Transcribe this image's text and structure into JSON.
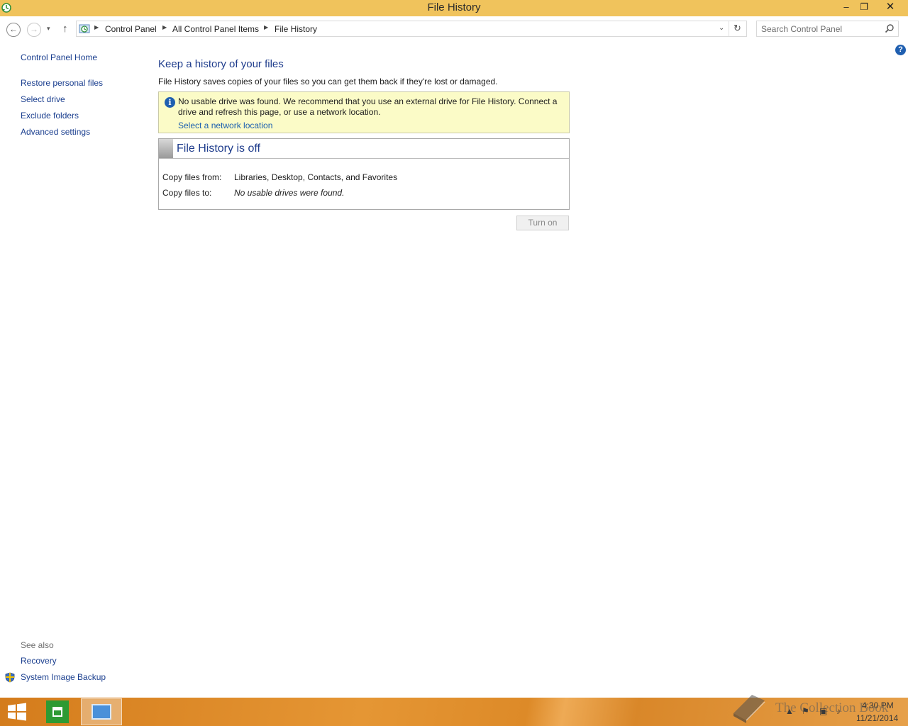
{
  "window": {
    "title": "File History",
    "minimize": "–",
    "maximize": "❐",
    "close": "✕"
  },
  "nav": {
    "back": "←",
    "forward": "→",
    "recent": "▾",
    "up": "↑",
    "breadcrumbs": [
      "Control Panel",
      "All Control Panel Items",
      "File History"
    ],
    "dropdown": "⌄",
    "refresh": "↻",
    "search_placeholder": "Search Control Panel"
  },
  "left_pane": {
    "home": "Control Panel Home",
    "tasks": [
      "Restore personal files",
      "Select drive",
      "Exclude folders",
      "Advanced settings"
    ],
    "see_also_label": "See also",
    "see_also": [
      "Recovery",
      "System Image Backup"
    ]
  },
  "main": {
    "title": "Keep a history of your files",
    "description": "File History saves copies of your files so you can get them back if they're lost or damaged.",
    "warning": {
      "message": "No usable drive was found. We recommend that you use an external drive for File History. Connect a drive and refresh this page, or use a network location.",
      "link": "Select a network location"
    },
    "status": {
      "title": "File History is off",
      "copy_from_label": "Copy files from:",
      "copy_from_value": "Libraries, Desktop, Contacts, and Favorites",
      "copy_to_label": "Copy files to:",
      "copy_to_value": "No usable drives were found."
    },
    "turn_on": "Turn on",
    "help": "?"
  },
  "taskbar": {
    "time": "4:30 PM",
    "date": "11/21/2014",
    "watermark": "The Collection Book"
  },
  "icons": {
    "app": "file-history-icon",
    "info": "info-icon",
    "help": "help-icon",
    "shield": "uac-shield-icon",
    "start": "windows-start-icon",
    "store": "store-icon",
    "control_panel": "control-panel-icon",
    "search": "magnifier-icon"
  },
  "colors": {
    "titlebar": "#f0c35c",
    "link": "#1b3f8f",
    "heading": "#1e3c8c",
    "warning_bg": "#fbfbc7",
    "taskbar": "#e08c2c"
  }
}
